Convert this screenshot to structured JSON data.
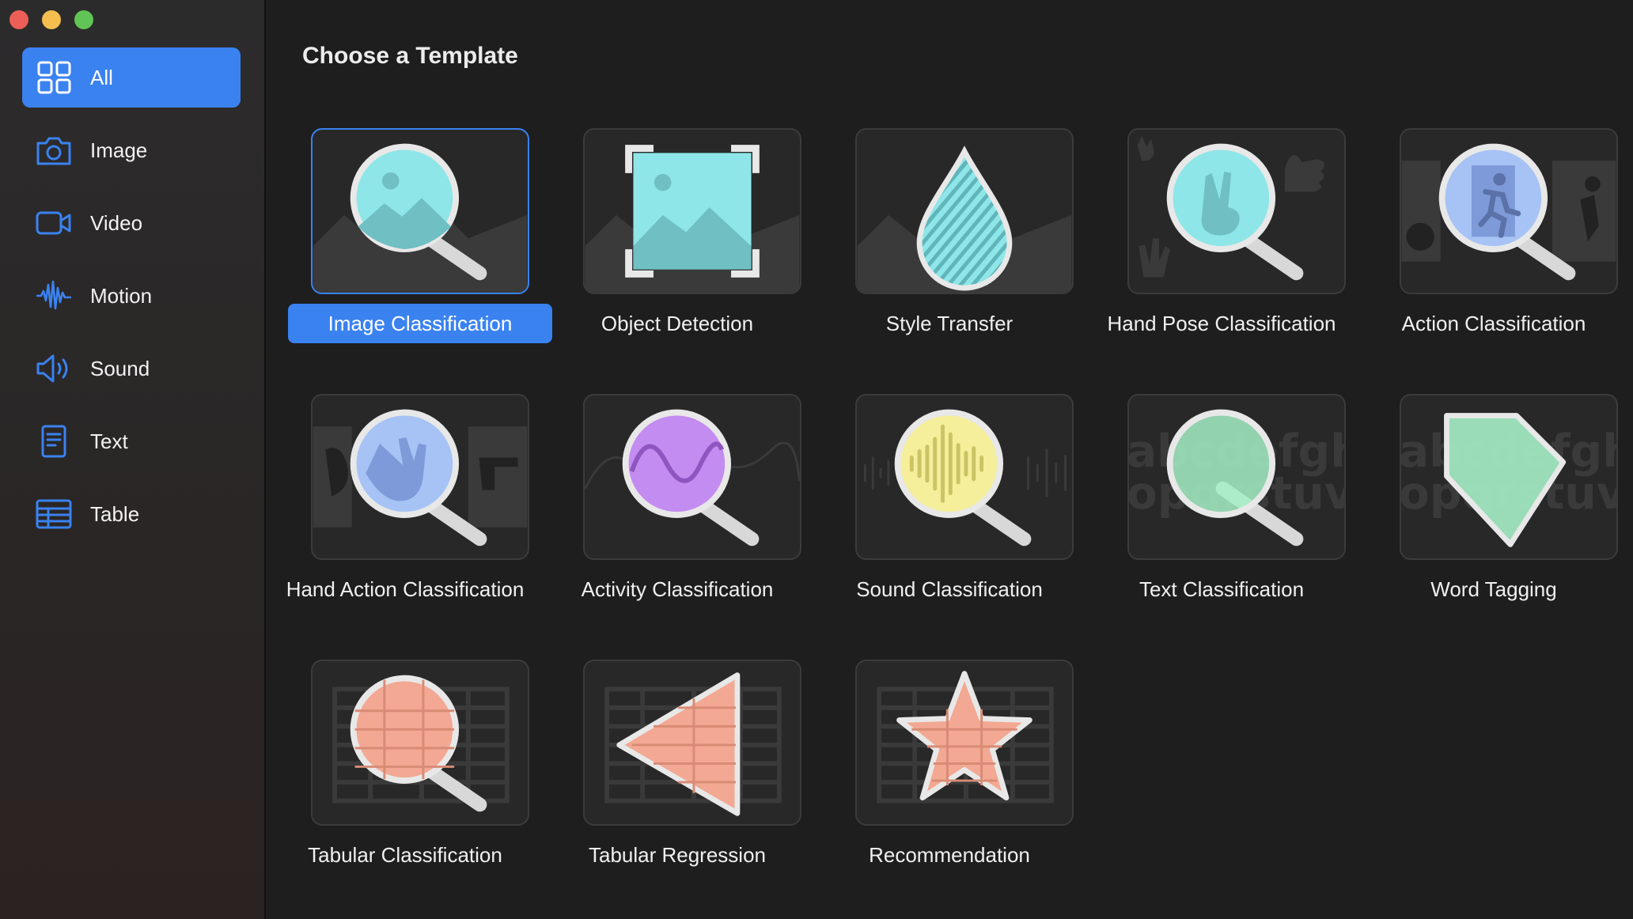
{
  "sidebar": {
    "items": [
      {
        "label": "All",
        "icon": "grid-icon"
      },
      {
        "label": "Image",
        "icon": "camera-icon"
      },
      {
        "label": "Video",
        "icon": "video-camera-icon"
      },
      {
        "label": "Motion",
        "icon": "waveform-icon"
      },
      {
        "label": "Sound",
        "icon": "speaker-icon"
      },
      {
        "label": "Text",
        "icon": "document-icon"
      },
      {
        "label": "Table",
        "icon": "table-icon"
      }
    ],
    "selected": "All"
  },
  "main": {
    "heading": "Choose a Template",
    "templates": [
      {
        "label": "Image Classification",
        "icon": "image-magnifier-icon",
        "selected": true
      },
      {
        "label": "Object Detection",
        "icon": "image-frame-icon"
      },
      {
        "label": "Style Transfer",
        "icon": "droplet-icon"
      },
      {
        "label": "Hand Pose Classification",
        "icon": "hand-peace-magnifier-icon"
      },
      {
        "label": "Action Classification",
        "icon": "running-figure-magnifier-icon"
      },
      {
        "label": "Hand Action Classification",
        "icon": "waving-hand-magnifier-icon"
      },
      {
        "label": "Activity Classification",
        "icon": "sine-wave-magnifier-icon"
      },
      {
        "label": "Sound Classification",
        "icon": "audio-waveform-magnifier-icon"
      },
      {
        "label": "Text Classification",
        "icon": "text-magnifier-icon"
      },
      {
        "label": "Word Tagging",
        "icon": "tag-icon"
      },
      {
        "label": "Tabular Classification",
        "icon": "table-magnifier-icon"
      },
      {
        "label": "Tabular Regression",
        "icon": "table-triangle-icon"
      },
      {
        "label": "Recommendation",
        "icon": "table-star-icon"
      }
    ],
    "thumb_text": {
      "line1": "abcdefghi",
      "line2": "opqrstuvw"
    }
  },
  "colors": {
    "accent": "#3a82f0",
    "image": "#8ee6e8",
    "activity": "#c38cf0",
    "sound": "#f5ee9a",
    "text": "#a6f0c6",
    "table": "#f2a892",
    "hand": "#a7c3f5"
  }
}
